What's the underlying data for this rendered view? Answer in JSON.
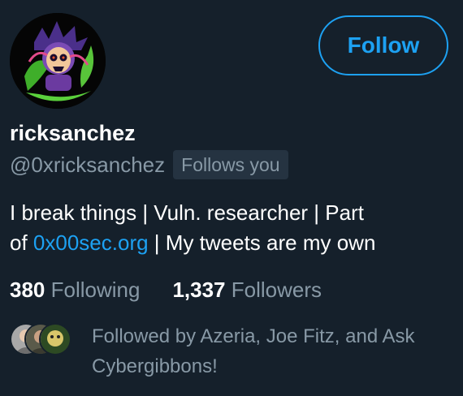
{
  "profile": {
    "display_name": "ricksanchez",
    "handle": "@0xricksanchez",
    "follows_you_badge": "Follows you",
    "follow_button_label": "Follow",
    "avatar_icon": "skull-avatar-icon"
  },
  "bio": {
    "line1": "I break things | Vuln. researcher | Part",
    "line2_prefix": "of ",
    "link_text": "0x00sec.org",
    "line2_suffix": " | My tweets are my own"
  },
  "stats": {
    "following_count": "380",
    "following_label": "Following",
    "followers_count": "1,337",
    "followers_label": "Followers"
  },
  "followed_by": {
    "text": "Followed by Azeria, Joe Fitz, and Ask Cybergibbons!"
  },
  "colors": {
    "background": "#15202b",
    "accent": "#1da1f2",
    "secondary_text": "#8899a6",
    "badge_bg": "#253341",
    "primary_text": "#ffffff"
  }
}
